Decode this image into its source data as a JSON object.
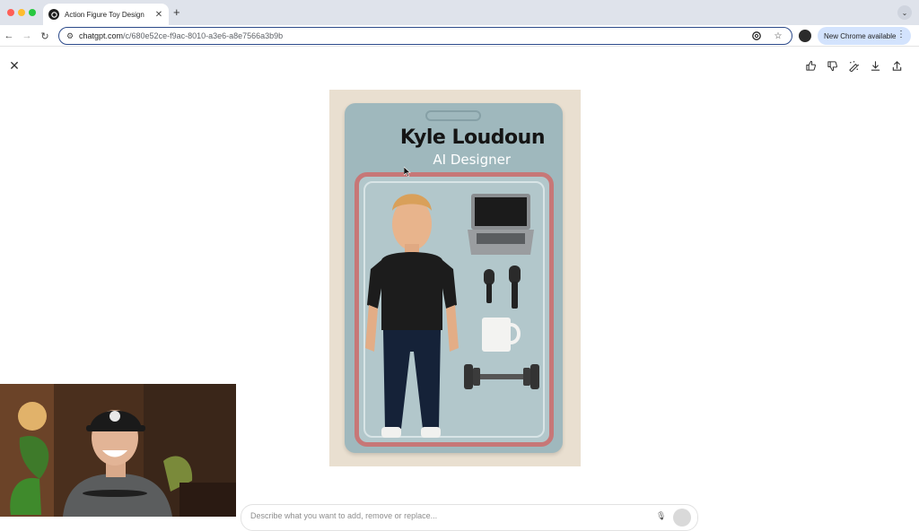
{
  "browser": {
    "tab_title": "Action Figure Toy Design",
    "new_tab_symbol": "+",
    "url_host": "chatgpt.com",
    "url_path": "/c/680e52ce-f9ac-8010-a3e6-a8e7566a3b9b",
    "update_button_label": "New Chrome available"
  },
  "image": {
    "toy_name": "Kyle Loudoun",
    "toy_role": "AI Designer"
  },
  "prompt": {
    "placeholder": "Describe what you want to add, remove or replace..."
  },
  "colors": {
    "card_bg": "#9fb8bd",
    "blister_border": "#c77777",
    "package_bg": "#e9dfd0",
    "omnibox_border": "#2c4a8a",
    "update_button_bg": "#d3e3fd"
  },
  "icons": {
    "page_actions": [
      "thumbs-up-icon",
      "thumbs-down-icon",
      "select-edit-icon",
      "download-icon",
      "share-icon"
    ]
  }
}
